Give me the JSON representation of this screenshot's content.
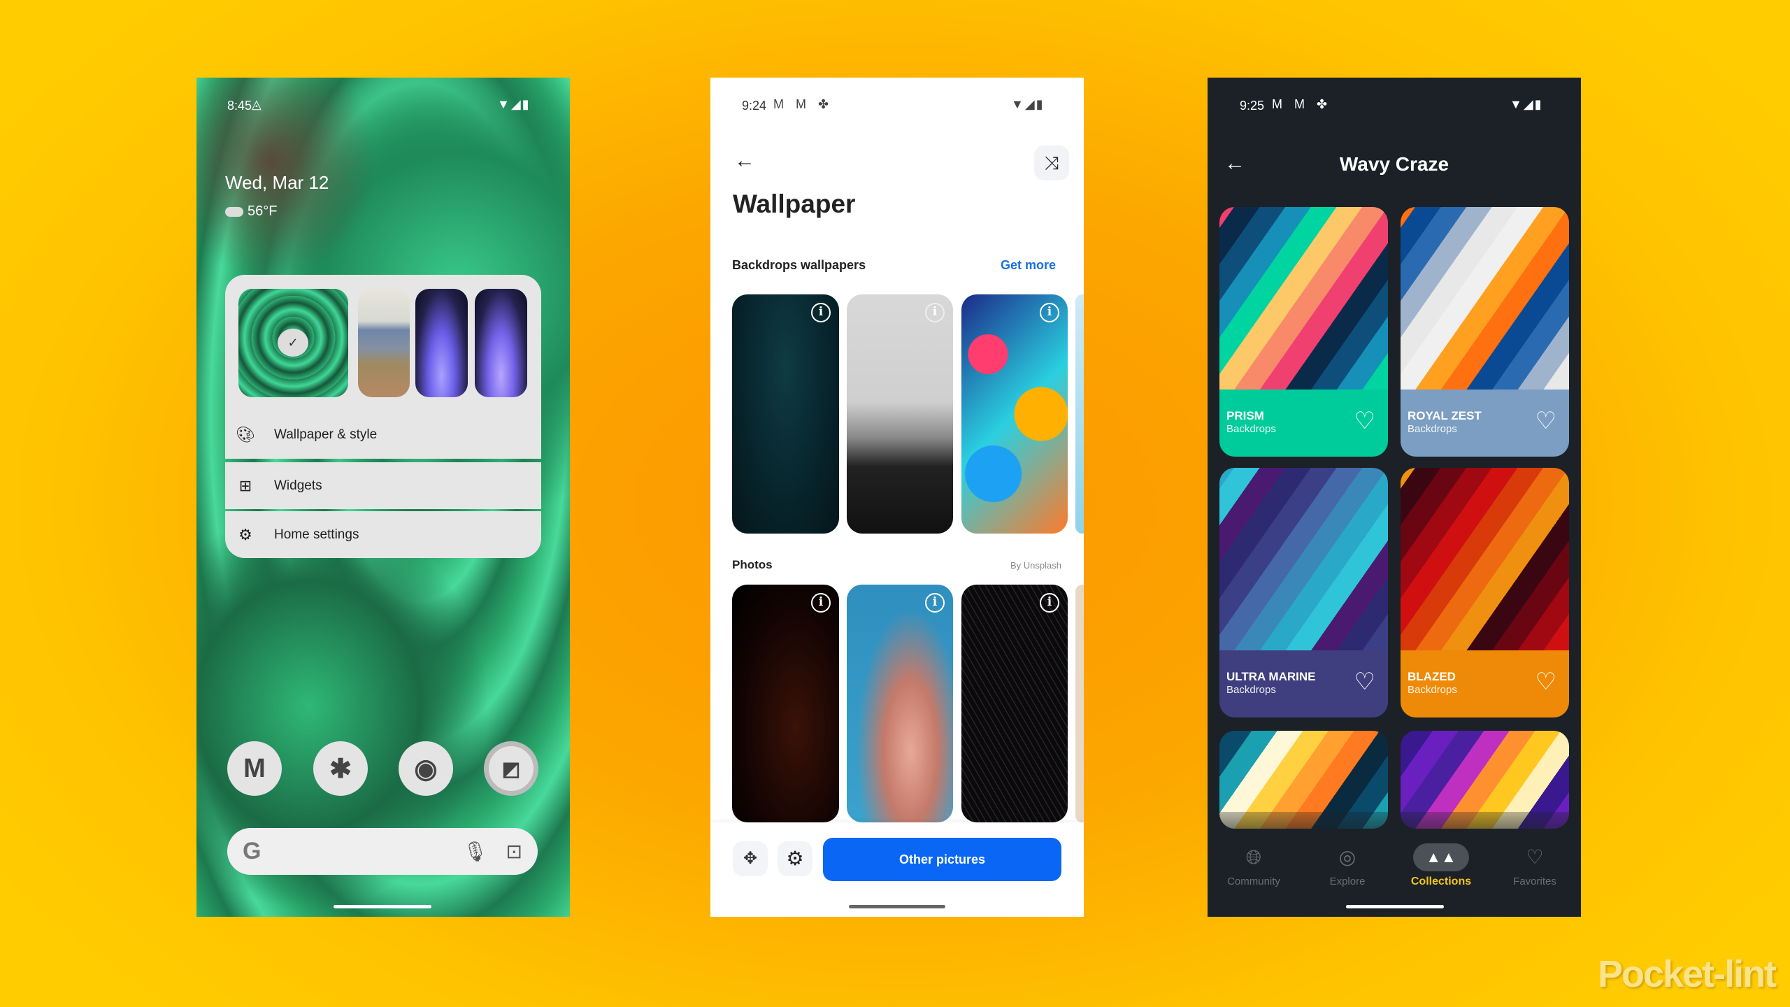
{
  "phone_home": {
    "status": {
      "time": "8:45",
      "icons": [
        "drive-icon",
        "wifi-icon",
        "signal-icon",
        "battery-icon"
      ]
    },
    "date": "Wed, Mar 12",
    "weather": {
      "icon": "cloud-icon",
      "temp": "56°F"
    },
    "menu": [
      {
        "icon": "palette-icon",
        "label": "Wallpaper & style"
      },
      {
        "icon": "widgets-icon",
        "label": "Widgets"
      },
      {
        "icon": "gear-icon",
        "label": "Home settings"
      }
    ],
    "dock": [
      "gmail-icon",
      "slack-icon",
      "chrome-icon",
      "screenshot-app-icon"
    ],
    "search": {
      "logo": "G",
      "icons": [
        "mic-icon",
        "lens-icon"
      ]
    }
  },
  "phone_wallpaper": {
    "status": {
      "time": "9:24"
    },
    "title": "Wallpaper",
    "section1": {
      "title": "Backdrops wallpapers",
      "link": "Get more"
    },
    "section2": {
      "title": "Photos",
      "credit": "By Unsplash"
    },
    "primary_button": "Other pictures",
    "accent": "#0a66f5"
  },
  "phone_collection": {
    "status": {
      "time": "9:25"
    },
    "title": "Wavy Craze",
    "cards": [
      {
        "name": "PRISM",
        "sub": "Backdrops",
        "color": "#00cc9b"
      },
      {
        "name": "ROYAL ZEST",
        "sub": "Backdrops",
        "color": "#7b9ec2"
      },
      {
        "name": "ULTRA MARINE",
        "sub": "Backdrops",
        "color": "#3f3f7f"
      },
      {
        "name": "BLAZED",
        "sub": "Backdrops",
        "color": "#ee8a07"
      }
    ],
    "nav": [
      {
        "label": "Community",
        "icon": "globe-icon"
      },
      {
        "label": "Explore",
        "icon": "compass-icon"
      },
      {
        "label": "Collections",
        "icon": "mountains-icon",
        "active": true
      },
      {
        "label": "Favorites",
        "icon": "heart-icon"
      }
    ],
    "active_color": "#f5c518"
  },
  "watermark": "Pocket-lint"
}
